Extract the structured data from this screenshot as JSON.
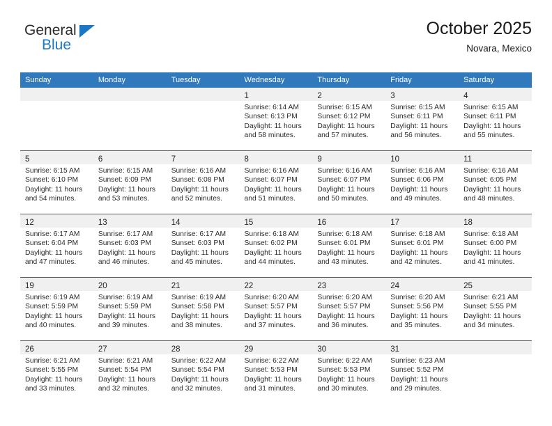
{
  "brand": {
    "name_part1": "General",
    "name_part2": "Blue",
    "triangle_icon": "triangle-icon",
    "accent_color": "#1b77c4"
  },
  "header": {
    "title": "October 2025",
    "subtitle": "Novara, Mexico"
  },
  "theme": {
    "header_blue": "#3179bd",
    "daynum_band_gray": "#f0f0f0",
    "row_border": "#5b5b5b",
    "text": "#2b2b2b"
  },
  "calendar": {
    "weekday_headers": [
      "Sunday",
      "Monday",
      "Tuesday",
      "Wednesday",
      "Thursday",
      "Friday",
      "Saturday"
    ],
    "weeks": [
      [
        {
          "day": "",
          "lines": []
        },
        {
          "day": "",
          "lines": []
        },
        {
          "day": "",
          "lines": []
        },
        {
          "day": "1",
          "lines": [
            "Sunrise: 6:14 AM",
            "Sunset: 6:13 PM",
            "Daylight: 11 hours",
            "and 58 minutes."
          ]
        },
        {
          "day": "2",
          "lines": [
            "Sunrise: 6:15 AM",
            "Sunset: 6:12 PM",
            "Daylight: 11 hours",
            "and 57 minutes."
          ]
        },
        {
          "day": "3",
          "lines": [
            "Sunrise: 6:15 AM",
            "Sunset: 6:11 PM",
            "Daylight: 11 hours",
            "and 56 minutes."
          ]
        },
        {
          "day": "4",
          "lines": [
            "Sunrise: 6:15 AM",
            "Sunset: 6:11 PM",
            "Daylight: 11 hours",
            "and 55 minutes."
          ]
        }
      ],
      [
        {
          "day": "5",
          "lines": [
            "Sunrise: 6:15 AM",
            "Sunset: 6:10 PM",
            "Daylight: 11 hours",
            "and 54 minutes."
          ]
        },
        {
          "day": "6",
          "lines": [
            "Sunrise: 6:15 AM",
            "Sunset: 6:09 PM",
            "Daylight: 11 hours",
            "and 53 minutes."
          ]
        },
        {
          "day": "7",
          "lines": [
            "Sunrise: 6:16 AM",
            "Sunset: 6:08 PM",
            "Daylight: 11 hours",
            "and 52 minutes."
          ]
        },
        {
          "day": "8",
          "lines": [
            "Sunrise: 6:16 AM",
            "Sunset: 6:07 PM",
            "Daylight: 11 hours",
            "and 51 minutes."
          ]
        },
        {
          "day": "9",
          "lines": [
            "Sunrise: 6:16 AM",
            "Sunset: 6:07 PM",
            "Daylight: 11 hours",
            "and 50 minutes."
          ]
        },
        {
          "day": "10",
          "lines": [
            "Sunrise: 6:16 AM",
            "Sunset: 6:06 PM",
            "Daylight: 11 hours",
            "and 49 minutes."
          ]
        },
        {
          "day": "11",
          "lines": [
            "Sunrise: 6:16 AM",
            "Sunset: 6:05 PM",
            "Daylight: 11 hours",
            "and 48 minutes."
          ]
        }
      ],
      [
        {
          "day": "12",
          "lines": [
            "Sunrise: 6:17 AM",
            "Sunset: 6:04 PM",
            "Daylight: 11 hours",
            "and 47 minutes."
          ]
        },
        {
          "day": "13",
          "lines": [
            "Sunrise: 6:17 AM",
            "Sunset: 6:03 PM",
            "Daylight: 11 hours",
            "and 46 minutes."
          ]
        },
        {
          "day": "14",
          "lines": [
            "Sunrise: 6:17 AM",
            "Sunset: 6:03 PM",
            "Daylight: 11 hours",
            "and 45 minutes."
          ]
        },
        {
          "day": "15",
          "lines": [
            "Sunrise: 6:18 AM",
            "Sunset: 6:02 PM",
            "Daylight: 11 hours",
            "and 44 minutes."
          ]
        },
        {
          "day": "16",
          "lines": [
            "Sunrise: 6:18 AM",
            "Sunset: 6:01 PM",
            "Daylight: 11 hours",
            "and 43 minutes."
          ]
        },
        {
          "day": "17",
          "lines": [
            "Sunrise: 6:18 AM",
            "Sunset: 6:01 PM",
            "Daylight: 11 hours",
            "and 42 minutes."
          ]
        },
        {
          "day": "18",
          "lines": [
            "Sunrise: 6:18 AM",
            "Sunset: 6:00 PM",
            "Daylight: 11 hours",
            "and 41 minutes."
          ]
        }
      ],
      [
        {
          "day": "19",
          "lines": [
            "Sunrise: 6:19 AM",
            "Sunset: 5:59 PM",
            "Daylight: 11 hours",
            "and 40 minutes."
          ]
        },
        {
          "day": "20",
          "lines": [
            "Sunrise: 6:19 AM",
            "Sunset: 5:59 PM",
            "Daylight: 11 hours",
            "and 39 minutes."
          ]
        },
        {
          "day": "21",
          "lines": [
            "Sunrise: 6:19 AM",
            "Sunset: 5:58 PM",
            "Daylight: 11 hours",
            "and 38 minutes."
          ]
        },
        {
          "day": "22",
          "lines": [
            "Sunrise: 6:20 AM",
            "Sunset: 5:57 PM",
            "Daylight: 11 hours",
            "and 37 minutes."
          ]
        },
        {
          "day": "23",
          "lines": [
            "Sunrise: 6:20 AM",
            "Sunset: 5:57 PM",
            "Daylight: 11 hours",
            "and 36 minutes."
          ]
        },
        {
          "day": "24",
          "lines": [
            "Sunrise: 6:20 AM",
            "Sunset: 5:56 PM",
            "Daylight: 11 hours",
            "and 35 minutes."
          ]
        },
        {
          "day": "25",
          "lines": [
            "Sunrise: 6:21 AM",
            "Sunset: 5:55 PM",
            "Daylight: 11 hours",
            "and 34 minutes."
          ]
        }
      ],
      [
        {
          "day": "26",
          "lines": [
            "Sunrise: 6:21 AM",
            "Sunset: 5:55 PM",
            "Daylight: 11 hours",
            "and 33 minutes."
          ]
        },
        {
          "day": "27",
          "lines": [
            "Sunrise: 6:21 AM",
            "Sunset: 5:54 PM",
            "Daylight: 11 hours",
            "and 32 minutes."
          ]
        },
        {
          "day": "28",
          "lines": [
            "Sunrise: 6:22 AM",
            "Sunset: 5:54 PM",
            "Daylight: 11 hours",
            "and 32 minutes."
          ]
        },
        {
          "day": "29",
          "lines": [
            "Sunrise: 6:22 AM",
            "Sunset: 5:53 PM",
            "Daylight: 11 hours",
            "and 31 minutes."
          ]
        },
        {
          "day": "30",
          "lines": [
            "Sunrise: 6:22 AM",
            "Sunset: 5:53 PM",
            "Daylight: 11 hours",
            "and 30 minutes."
          ]
        },
        {
          "day": "31",
          "lines": [
            "Sunrise: 6:23 AM",
            "Sunset: 5:52 PM",
            "Daylight: 11 hours",
            "and 29 minutes."
          ]
        },
        {
          "day": "",
          "lines": []
        }
      ]
    ]
  }
}
